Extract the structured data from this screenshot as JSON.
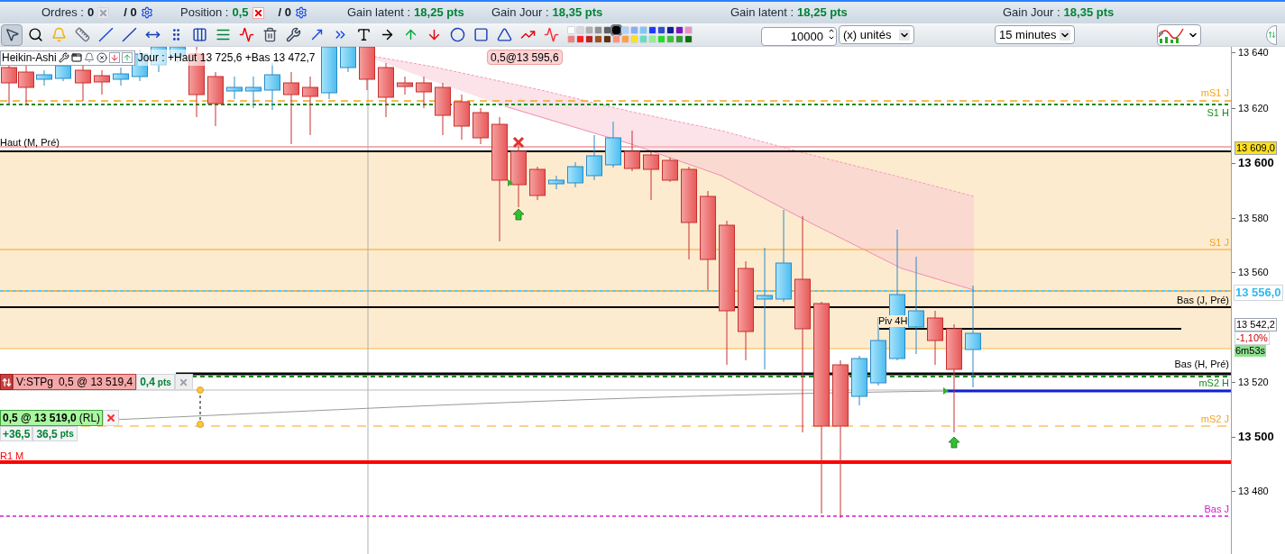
{
  "top_bar": [
    {
      "kind": "counter",
      "label": "Ordres :",
      "value": "0",
      "cancel_enabled": false,
      "separator": "/ 0"
    },
    {
      "kind": "counter",
      "label": "Position :",
      "value": "0,5",
      "cancel_enabled": true,
      "separator": "/ 0"
    },
    {
      "kind": "gain",
      "label": "Gain latent :",
      "value": "18,25 pts"
    },
    {
      "kind": "gain",
      "label": "Gain Jour :",
      "value": "18,35 pts"
    },
    {
      "kind": "gain",
      "label": "Gain latent :",
      "value": "18,25 pts"
    },
    {
      "kind": "gain",
      "label": "Gain Jour :",
      "value": "18,35 pts"
    }
  ],
  "toolbar": {
    "tools": [
      {
        "kind": "pointer",
        "selected": true
      },
      {
        "kind": "zoom",
        "selected": false
      },
      {
        "kind": "alert",
        "selected": false
      },
      {
        "kind": "ruler",
        "selected": false
      },
      {
        "kind": "segment",
        "selected": false
      },
      {
        "kind": "line",
        "selected": false
      },
      {
        "kind": "horizontal",
        "selected": false
      },
      {
        "kind": "vertical",
        "selected": false
      },
      {
        "kind": "channel",
        "selected": false
      },
      {
        "kind": "fibonacci",
        "selected": false
      },
      {
        "kind": "wave",
        "selected": false
      },
      {
        "kind": "trash",
        "selected": false
      },
      {
        "kind": "tools",
        "selected": false
      },
      {
        "kind": "extend",
        "selected": false
      },
      {
        "kind": "parallel",
        "selected": false
      },
      {
        "kind": "text",
        "selected": false
      },
      {
        "kind": "arrow-right",
        "selected": false
      },
      {
        "kind": "arrow-up",
        "selected": false
      },
      {
        "kind": "arrow-down",
        "selected": false
      },
      {
        "kind": "ellipse",
        "selected": false
      },
      {
        "kind": "rectangle",
        "selected": false
      },
      {
        "kind": "triangle",
        "selected": false
      },
      {
        "kind": "zigzag",
        "selected": false
      },
      {
        "kind": "wedge",
        "selected": false
      }
    ],
    "palette": [
      {
        "color": "#ffffff",
        "selected": false
      },
      {
        "color": "#d8d8d8",
        "selected": false
      },
      {
        "color": "#b0b0b0",
        "selected": false
      },
      {
        "color": "#909090",
        "selected": false
      },
      {
        "color": "#606060",
        "selected": false
      },
      {
        "color": "#000000",
        "selected": true
      },
      {
        "color": "#b0d0ff",
        "selected": false
      },
      {
        "color": "#80b0ff",
        "selected": false
      },
      {
        "color": "#7ec8f8",
        "selected": false
      },
      {
        "color": "#1e3cff",
        "selected": false
      },
      {
        "color": "#3050d0",
        "selected": false
      },
      {
        "color": "#102090",
        "selected": false
      },
      {
        "color": "#8010c0",
        "selected": false
      },
      {
        "color": "#f090c0",
        "selected": false
      },
      {
        "color": "#f08080",
        "selected": false
      },
      {
        "color": "#ff2020",
        "selected": false
      },
      {
        "color": "#c02020",
        "selected": false
      },
      {
        "color": "#a05020",
        "selected": false
      },
      {
        "color": "#603010",
        "selected": false
      },
      {
        "color": "#ff9080",
        "selected": false
      },
      {
        "color": "#ffa040",
        "selected": false
      },
      {
        "color": "#ffe020",
        "selected": false
      },
      {
        "color": "#60e0c0",
        "selected": false
      },
      {
        "color": "#90f090",
        "selected": false
      },
      {
        "color": "#20e020",
        "selected": false
      },
      {
        "color": "#40c040",
        "selected": false
      },
      {
        "color": "#30a030",
        "selected": false
      },
      {
        "color": "#107010",
        "selected": false
      }
    ],
    "quantity": {
      "value": "10000"
    },
    "unit_select": {
      "value": "(x) unités"
    },
    "timeframe_select": {
      "value": "15 minutes"
    }
  },
  "chart": {
    "style": "Heikin-Ashi",
    "info": "Jour : +Haut 13 725,6 +Bas 13 472,7",
    "trade_label": "0,5@13 595,6",
    "levels": [
      {
        "label": "mS1 J",
        "color": "#f7a21b"
      },
      {
        "label": "S1 H",
        "color": "#1a8a1a"
      },
      {
        "label": "Haut (M, Pré)",
        "color": "#000000"
      },
      {
        "label": "S1 J",
        "color": "#f7a21b"
      },
      {
        "label": "Bas (J, Pré)",
        "color": "#000000"
      },
      {
        "label": "Piv 4H",
        "color": "#000000"
      },
      {
        "label": "Bas (H, Pré)",
        "color": "#000000"
      },
      {
        "label": "mS2 H",
        "color": "#1a8a1a"
      },
      {
        "label": "mS2 J",
        "color": "#f7a21b"
      },
      {
        "label": "R1 M",
        "color": "#ff0000"
      },
      {
        "label": "Bas J",
        "color": "#d020d0"
      }
    ],
    "stop_order": {
      "label": "V:STPg",
      "order": "0,5 @ 13 519,4",
      "distance": "0,4",
      "unit": "pts"
    },
    "position_order": {
      "order": "0,5 @ 13 519,0",
      "suffix": "(RL)",
      "gain": "+36,5",
      "gain_pts": "36,5",
      "unit": "pts"
    }
  },
  "price_axis": {
    "ticks": [
      {
        "label": "13 640",
        "bold": false
      },
      {
        "label": "13 620",
        "bold": false
      },
      {
        "label": "13 600",
        "bold": true
      },
      {
        "label": "13 580",
        "bold": false
      },
      {
        "label": "13 560",
        "bold": false
      },
      {
        "label": "13 520",
        "bold": false
      },
      {
        "label": "13 500",
        "bold": true
      },
      {
        "label": "13 480",
        "bold": false
      }
    ],
    "tags": [
      {
        "kind": "marker",
        "text": "13 609,0"
      },
      {
        "kind": "last",
        "text": "13 556,0"
      },
      {
        "kind": "price",
        "text": "13 542,2"
      },
      {
        "kind": "change",
        "text": "-1,10%"
      },
      {
        "kind": "timer",
        "text": "6m53s"
      }
    ]
  }
}
